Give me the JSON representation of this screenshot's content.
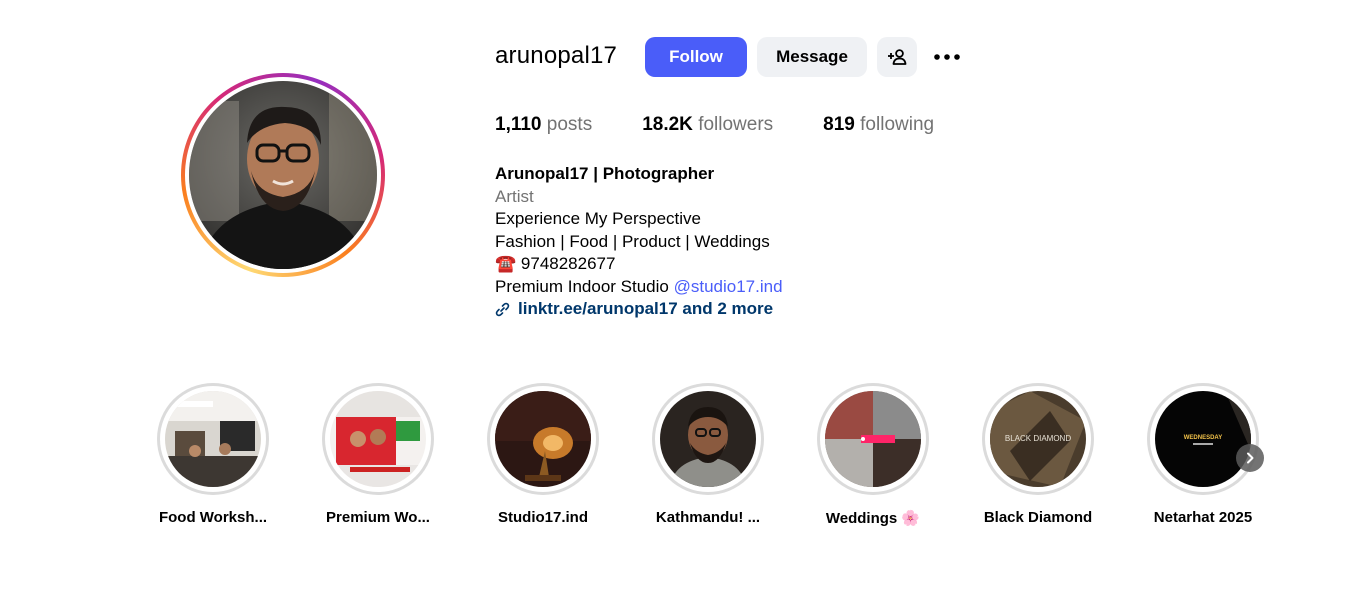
{
  "profile": {
    "username": "arunopal17",
    "follow_label": "Follow",
    "message_label": "Message",
    "suggest_icon": "add-person-icon",
    "more_icon": "more-options-icon"
  },
  "stats": {
    "posts_value": "1,110",
    "posts_label": "posts",
    "followers_value": "18.2K",
    "followers_label": "followers",
    "following_value": "819",
    "following_label": "following"
  },
  "bio": {
    "name": "Arunopal17 | Photographer",
    "category": "Artist",
    "line1": "Experience My Perspective",
    "line2": "Fashion | Food | Product | Weddings",
    "phone_emoji": "☎️",
    "phone": "9748282677",
    "studio_prefix": "Premium Indoor Studio",
    "studio_mention": "@studio17.ind",
    "link_text": "linktr.ee/arunopal17 and 2 more"
  },
  "highlights": [
    {
      "label": "Food Worksh..."
    },
    {
      "label": "Premium Wo..."
    },
    {
      "label": "Studio17.ind"
    },
    {
      "label": "Kathmandu! ..."
    },
    {
      "label": "Weddings 🌸"
    },
    {
      "label": "Black Diamond"
    },
    {
      "label": "Netarhat 2025"
    }
  ],
  "highlight_images": {
    "black_diamond_text": "BLACK DIAMOND",
    "netarhat_text": "WEDNESDAY"
  },
  "colors": {
    "accent": "#4a5df9",
    "secondary_button": "#eff1f4",
    "muted_text": "#737373",
    "link": "#00376b"
  }
}
